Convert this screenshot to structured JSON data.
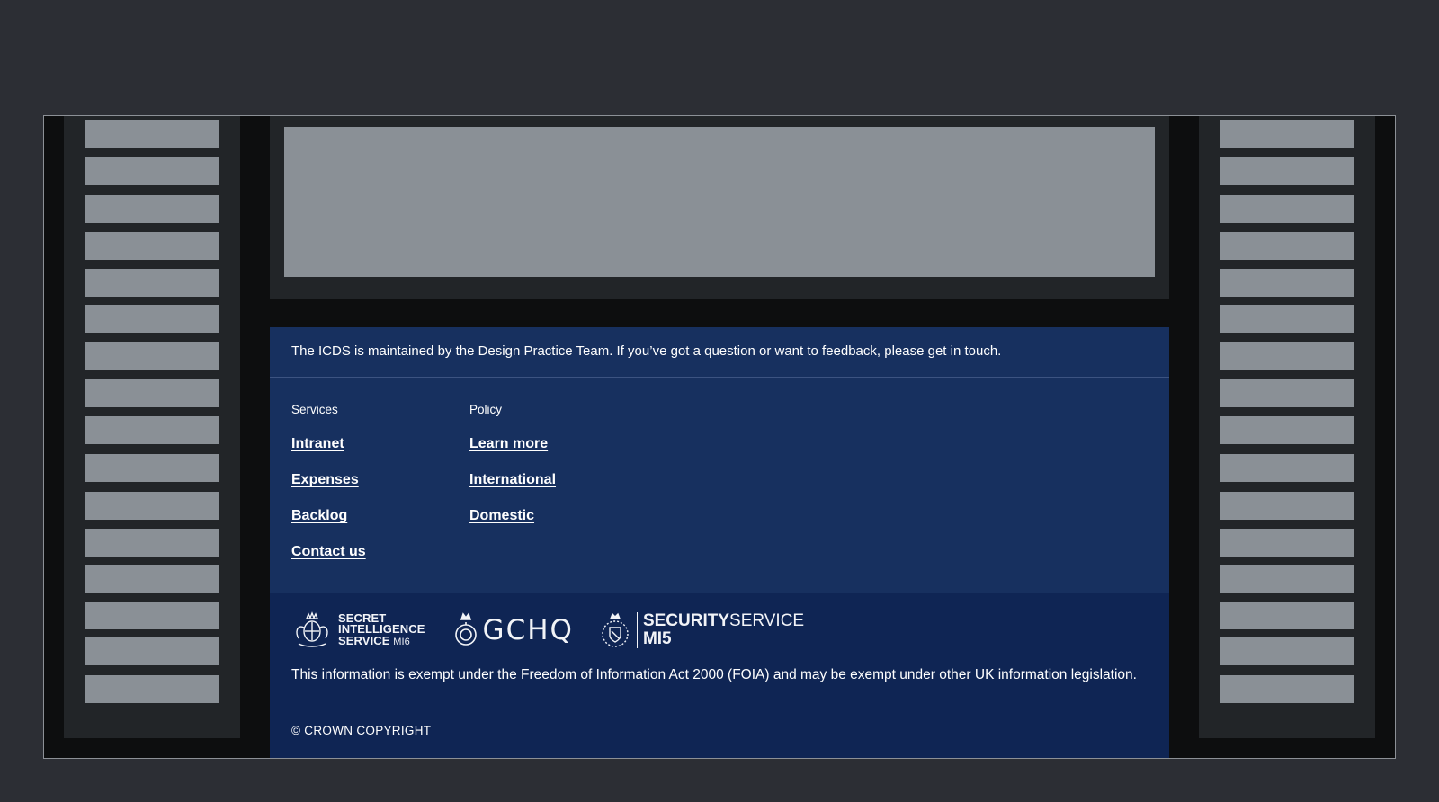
{
  "feedback": {
    "text": "The ICDS is maintained by the Design Practice Team. If you’ve got a question or want to feedback, please get in touch."
  },
  "services": {
    "heading": "Services",
    "links": [
      "Intranet",
      "Expenses",
      "Backlog",
      "Contact us"
    ]
  },
  "policy": {
    "heading": "Policy",
    "links": [
      "Learn more",
      "International",
      "Domestic"
    ]
  },
  "logos": {
    "mi6": {
      "line1": "SECRET",
      "line2": "INTELLIGENCE",
      "line3a": "SERVICE",
      "line3b": "MI6",
      "icon": "royal-crest-icon"
    },
    "gchq": {
      "text": "GCHQ",
      "icon": "gchq-crest-icon"
    },
    "mi5": {
      "bold": "SECURITY",
      "thin": "SERVICE",
      "line2": "MI5",
      "icon": "mi5-crest-icon"
    }
  },
  "legal": {
    "foia": "This information is exempt under the Freedom of Information Act 2000 (FOIA) and may be exempt under other UK information legislation.",
    "copyright": "© CROWN COPYRIGHT"
  },
  "colors": {
    "page_bg": "#2c2e34",
    "placeholder": "#8a9096",
    "footer_bg": "#17305f",
    "footer_lower_bg": "#0f2554",
    "text": "#ffffff"
  }
}
